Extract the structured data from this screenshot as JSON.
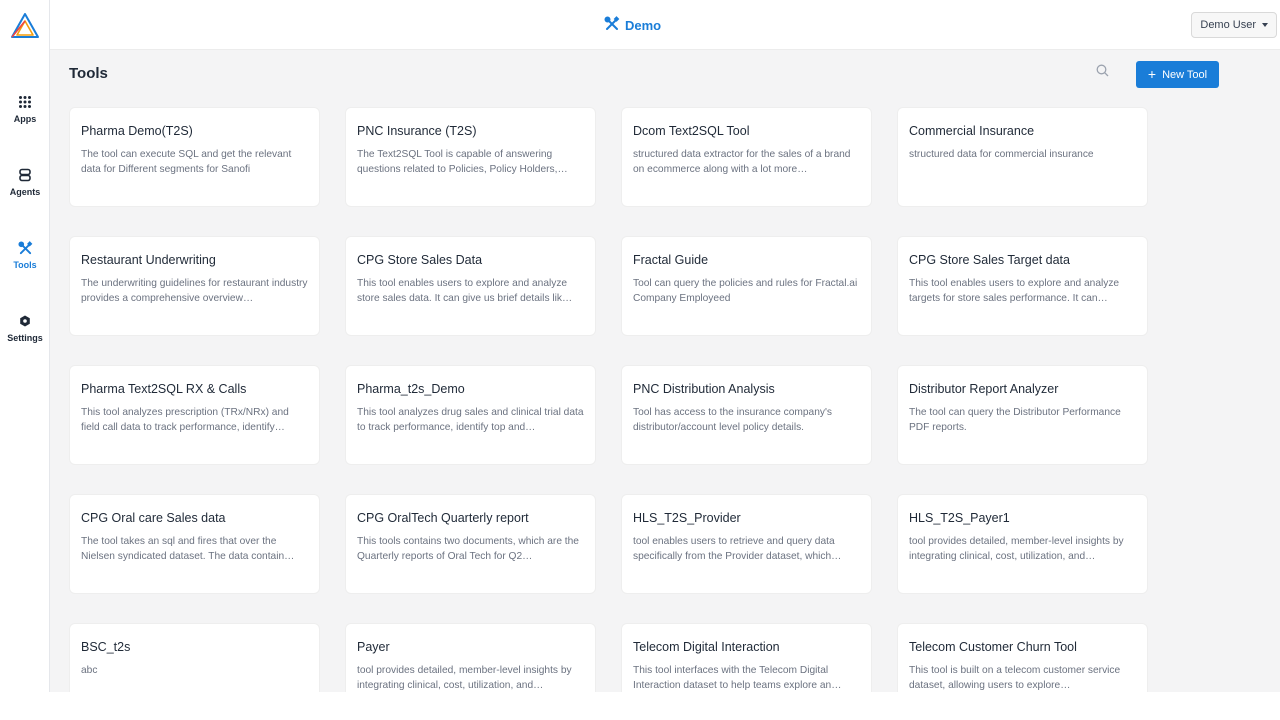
{
  "app": {
    "name": "Demo",
    "user": "Demo User",
    "accent": "#1a7dd8"
  },
  "sidebar": {
    "items": [
      {
        "label": "Apps",
        "icon": "grid-dots-icon"
      },
      {
        "label": "Agents",
        "icon": "robot-icon"
      },
      {
        "label": "Tools",
        "icon": "tools-icon"
      },
      {
        "label": "Settings",
        "icon": "gear-icon"
      }
    ],
    "active": "Tools"
  },
  "page": {
    "title": "Tools",
    "new_tool_label": "New Tool"
  },
  "tools": [
    {
      "title": "Pharma Demo(T2S)",
      "desc": "The tool can execute SQL and get the relevant data for Different segments for Sanofi"
    },
    {
      "title": "PNC Insurance (T2S)",
      "desc": "The Text2SQL Tool is capable of answering questions related to Policies, Policy Holders,…"
    },
    {
      "title": "Dcom Text2SQL Tool",
      "desc": "structured data extractor for the sales of a brand on ecommerce along with a lot more…"
    },
    {
      "title": "Commercial Insurance",
      "desc": "structured data for commercial insurance"
    },
    {
      "title": "Restaurant Underwriting",
      "desc": "The underwriting guidelines for restaurant industry provides a comprehensive overview…"
    },
    {
      "title": "CPG Store Sales Data",
      "desc": "This tool enables users to explore and analyze store sales data. It can give us brief details lik…"
    },
    {
      "title": "Fractal Guide",
      "desc": "Tool can query the policies and rules for Fractal.ai Company Employeed"
    },
    {
      "title": "CPG Store Sales Target data",
      "desc": "This tool enables users to explore and analyze targets for store sales performance. It can…"
    },
    {
      "title": "Pharma Text2SQL RX & Calls",
      "desc": "This tool analyzes prescription (TRx/NRx) and field call data to track performance, identify…"
    },
    {
      "title": "Pharma_t2s_Demo",
      "desc": "This tool analyzes drug sales and clinical trial data to track performance, identify top and…"
    },
    {
      "title": "PNC Distribution Analysis",
      "desc": "Tool has access to the insurance company's distributor/account level policy details."
    },
    {
      "title": "Distributor Report Analyzer",
      "desc": "The tool can query the Distributor Performance PDF reports."
    },
    {
      "title": "CPG Oral care Sales data",
      "desc": "The tool takes an sql and fires that over the Nielsen syndicated dataset. The data contain…"
    },
    {
      "title": "CPG OralTech Quarterly report",
      "desc": "This tools contains two documents, which are the Quarterly reports of Oral Tech for Q2…"
    },
    {
      "title": "HLS_T2S_Provider",
      "desc": "tool enables users to retrieve and query data specifically from the Provider dataset, which…"
    },
    {
      "title": "HLS_T2S_Payer1",
      "desc": "tool provides detailed, member-level insights by integrating clinical, cost, utilization, and…"
    },
    {
      "title": "BSC_t2s",
      "desc": "abc"
    },
    {
      "title": "Payer",
      "desc": "tool provides detailed, member-level insights by integrating clinical, cost, utilization, and…"
    },
    {
      "title": "Telecom Digital Interaction",
      "desc": "This tool interfaces with the Telecom Digital Interaction dataset to help teams explore an…"
    },
    {
      "title": "Telecom Customer Churn Tool",
      "desc": "This tool is built on a telecom customer service dataset, allowing users to explore…"
    }
  ]
}
